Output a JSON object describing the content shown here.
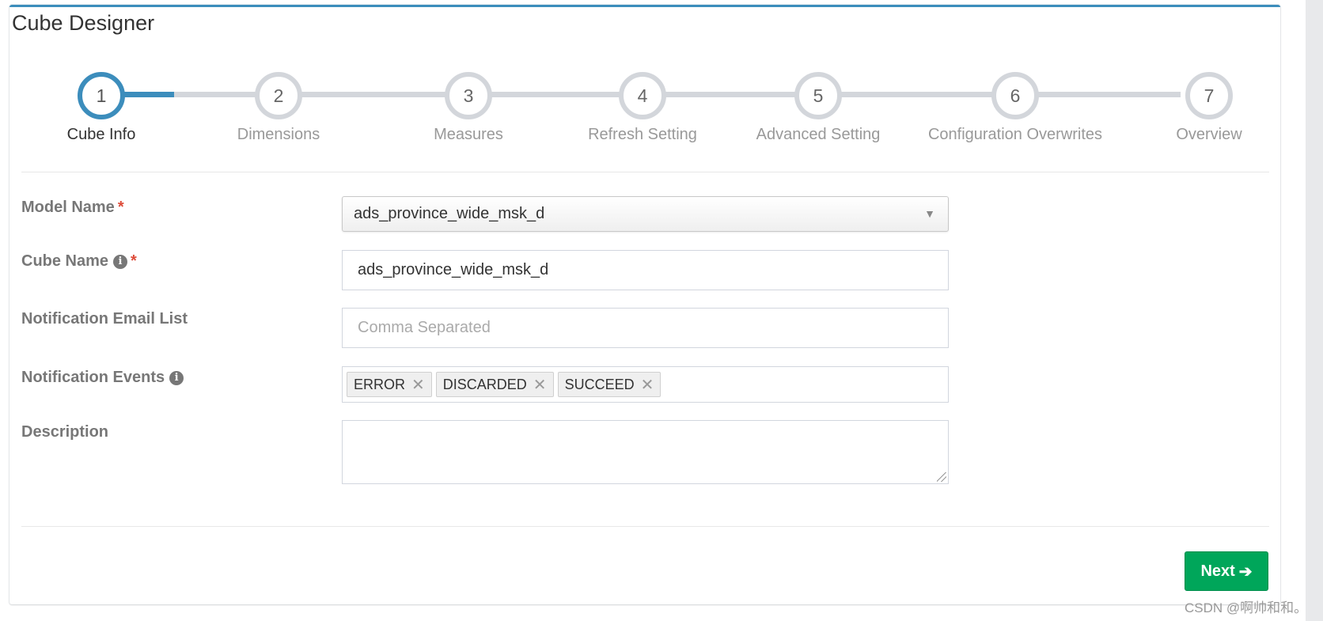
{
  "panel": {
    "title": "Cube Designer"
  },
  "wizard": {
    "steps": [
      {
        "number": "1",
        "label": "Cube Info",
        "active": true
      },
      {
        "number": "2",
        "label": "Dimensions",
        "active": false
      },
      {
        "number": "3",
        "label": "Measures",
        "active": false
      },
      {
        "number": "4",
        "label": "Refresh Setting",
        "active": false
      },
      {
        "number": "5",
        "label": "Advanced Setting",
        "active": false
      },
      {
        "number": "6",
        "label": "Configuration Overwrites",
        "active": false
      },
      {
        "number": "7",
        "label": "Overview",
        "active": false
      }
    ]
  },
  "form": {
    "model_name": {
      "label": "Model Name",
      "required_mark": "*",
      "value": "ads_province_wide_msk_d"
    },
    "cube_name": {
      "label": "Cube Name",
      "required_mark": "*",
      "value": "ads_province_wide_msk_d"
    },
    "notification_email": {
      "label": "Notification Email List",
      "value": "",
      "placeholder": "Comma Separated"
    },
    "notification_events": {
      "label": "Notification Events",
      "tags": [
        "ERROR",
        "DISCARDED",
        "SUCCEED"
      ],
      "remove_glyph": "✕"
    },
    "description": {
      "label": "Description",
      "value": ""
    }
  },
  "icons": {
    "info": "i",
    "select_arrow": "▼"
  },
  "actions": {
    "next_label": "Next",
    "next_icon": "➔"
  },
  "watermark": "CSDN @啊帅和和。",
  "colors": {
    "accent": "#3c8dbc",
    "success": "#00a65a",
    "required": "#dd4b39"
  }
}
